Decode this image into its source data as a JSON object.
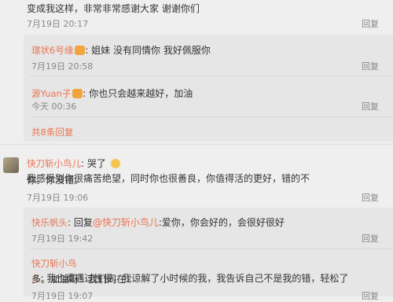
{
  "top": {
    "text": "变成我这样，非常非常感谢大家 谢谢你们",
    "date": "7月19日 20:17",
    "reply": "回复"
  },
  "replies1": [
    {
      "name": "璟状6号缘",
      "text": ": 姐妹 没有同情你 我好佩服你",
      "date": "7月19日 20:58",
      "reply": "回复"
    },
    {
      "name": "源Yuan子",
      "text": ": 你也只会越来越好，加油",
      "date": "今天 00:36",
      "reply": "回复"
    }
  ],
  "more_replies": "共8条回复",
  "comment2": {
    "name": "快刀斩小鸟儿",
    "text_a": ": 哭了",
    "text_b": "我感受到你很痛苦绝望，同时你也很善良，你值得活的更好，错的不",
    "line2": "你。你没错。",
    "date": "7月19日 19:06",
    "reply": "回复"
  },
  "replies2": [
    {
      "name": "快乐帆头",
      "text_a": ": 回复",
      "mention": "@快刀斩小鸟儿",
      "text_b": ":爱你，你会好的，会很好很好",
      "date": "7月19日 19:42",
      "reply": "回复"
    },
    {
      "name": "快刀斩小鸟儿",
      "text": ": 我也遭遇过性侵，我谅解了小时候的我，我告诉自己不是我的错，轻松了",
      "line2": "多。加油呀！我们同在！",
      "date": "7月19日 19:07",
      "reply": "回复"
    }
  ]
}
